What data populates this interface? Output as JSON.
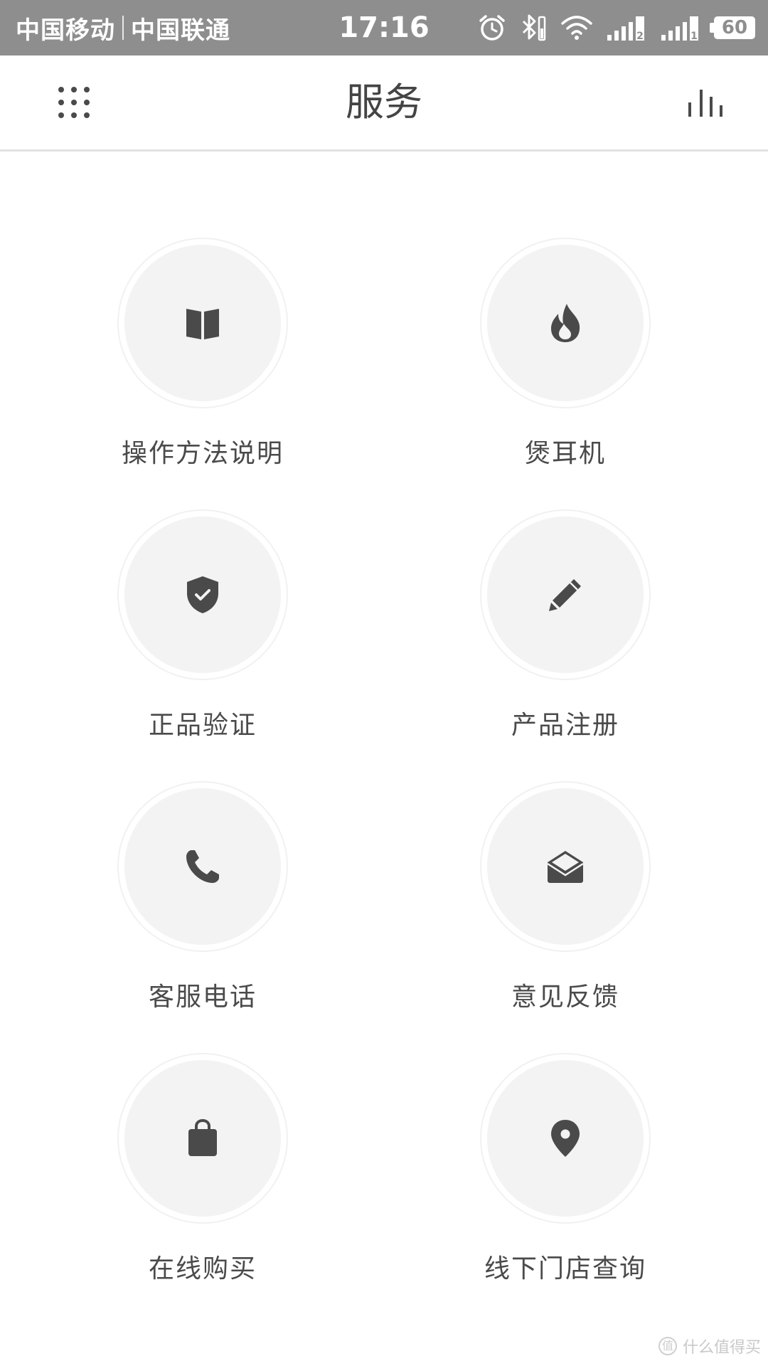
{
  "status_bar": {
    "carrier_1": "中国移动",
    "carrier_2": "中国联通",
    "time": "17:16",
    "icons": [
      "alarm-icon",
      "bluetooth-icon",
      "wifi-icon",
      "signal-sim2-icon",
      "signal-sim1-icon"
    ],
    "signal_1_label": "2",
    "signal_2_label": "1",
    "battery": "60"
  },
  "nav": {
    "title": "服务",
    "left_icon": "grid-menu-icon",
    "right_icon": "equalizer-icon"
  },
  "services": [
    {
      "label": "操作方法说明",
      "icon": "book-icon"
    },
    {
      "label": "煲耳机",
      "icon": "flame-icon"
    },
    {
      "label": "正品验证",
      "icon": "shield-check-icon"
    },
    {
      "label": "产品注册",
      "icon": "pencil-icon"
    },
    {
      "label": "客服电话",
      "icon": "phone-icon"
    },
    {
      "label": "意见反馈",
      "icon": "mail-open-icon"
    },
    {
      "label": "在线购买",
      "icon": "shopping-bag-icon"
    },
    {
      "label": "线下门店查询",
      "icon": "location-pin-icon"
    }
  ],
  "watermark": {
    "badge": "值",
    "text": "什么值得买"
  },
  "colors": {
    "status_bar_bg": "#8e8e8e",
    "icon": "#4a4a4a",
    "circle_bg": "#f3f3f3"
  }
}
